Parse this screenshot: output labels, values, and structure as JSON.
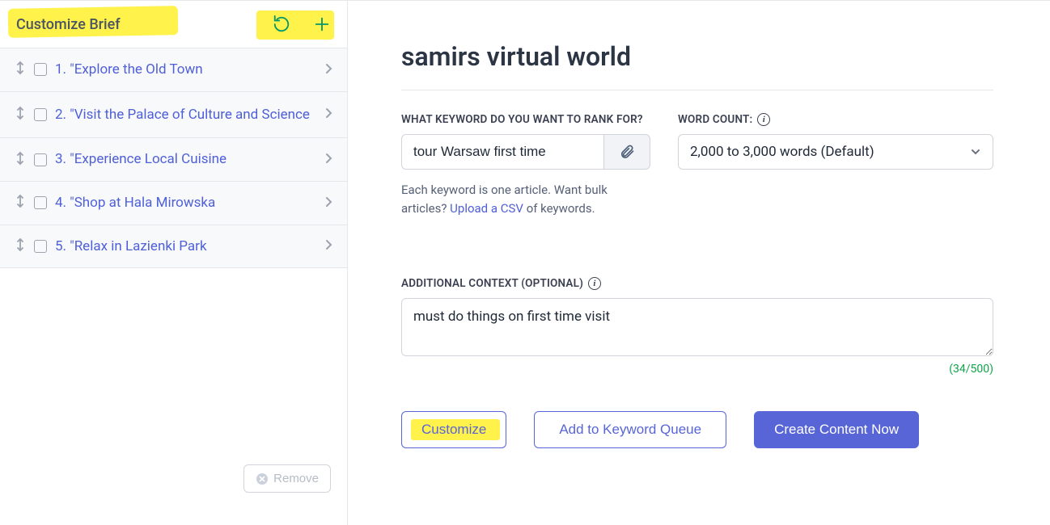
{
  "sidebar": {
    "title": "Customize Brief",
    "items": [
      {
        "label": "1. \"Explore the Old Town"
      },
      {
        "label": "2. \"Visit the Palace of Culture and Science"
      },
      {
        "label": "3. \"Experience Local Cuisine"
      },
      {
        "label": "4. \"Shop at Hala Mirowska"
      },
      {
        "label": "5. \"Relax in Lazienki Park"
      }
    ],
    "remove_label": "Remove"
  },
  "main": {
    "title": "samirs virtual world",
    "keyword_label": "WHAT KEYWORD DO YOU WANT TO RANK FOR?",
    "keyword_value": "tour Warsaw first time",
    "wordcount_label": "WORD COUNT:",
    "wordcount_value": "2,000 to 3,000 words (Default)",
    "help_text_1": "Each keyword is one article. Want bulk articles? ",
    "help_link": "Upload a CSV",
    "help_text_2": " of keywords.",
    "context_label": "ADDITIONAL CONTEXT (OPTIONAL)",
    "context_value": "must do things on first time visit",
    "char_count": "(34/500)",
    "customize_btn": "Customize",
    "queue_btn": "Add to Keyword Queue",
    "create_btn": "Create Content Now"
  }
}
